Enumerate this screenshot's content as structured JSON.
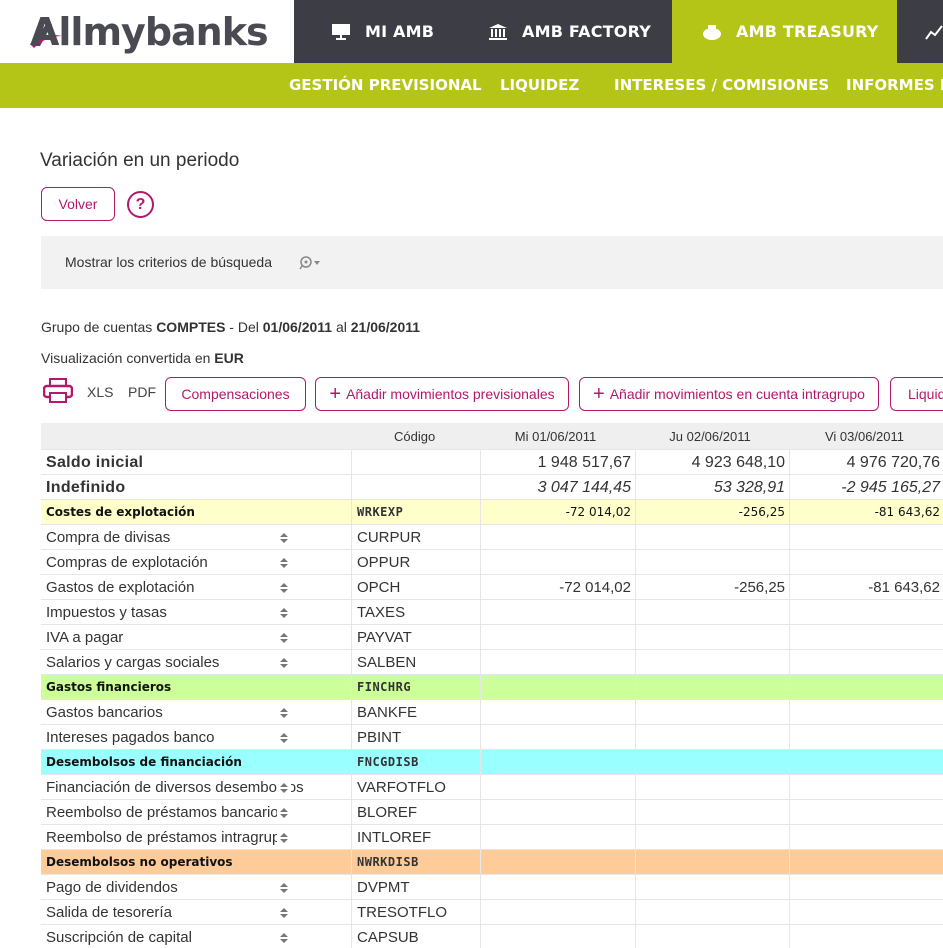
{
  "brand": {
    "logo_text": "Allmybanks",
    "accent": "#b5c517",
    "primary": "#b2196d",
    "dark": "#3d3d45"
  },
  "nav": {
    "items": [
      {
        "label": "MI AMB",
        "icon": "presentation-icon"
      },
      {
        "label": "AMB FACTORY",
        "icon": "bank-icon"
      },
      {
        "label": "AMB TREASURY",
        "icon": "piggy-bank-icon",
        "active": true
      },
      {
        "label": "",
        "icon": "chart-line-icon"
      }
    ]
  },
  "subnav": {
    "items": [
      "GESTIÓN PREVISIONAL",
      "LIQUIDEZ",
      "INTERESES / COMISIONES",
      "INFORMES DE"
    ]
  },
  "page": {
    "title": "Variación en un periodo",
    "back_label": "Volver",
    "help_label": "?",
    "criteria_label": "Mostrar los criterios de búsqueda"
  },
  "info": {
    "group_prefix": "Grupo de cuentas ",
    "group_name": "COMPTES",
    "from_prefix": " - Del ",
    "date_from": "01/06/2011",
    "to_prefix": " al ",
    "date_to": "21/06/2011",
    "currency_prefix": "Visualización convertida en ",
    "currency": "EUR"
  },
  "toolbar": {
    "xls": "XLS",
    "pdf": "PDF",
    "compensaciones": "Compensaciones",
    "add_prev": "Añadir movimientos previsionales",
    "add_intra": "Añadir movimientos en cuenta intragrupo",
    "liquid": "Liquid"
  },
  "table": {
    "headers": {
      "code": "Código",
      "d1": "Mi 01/06/2011",
      "d2": "Ju 02/06/2011",
      "d3": "Vi 03/06/2011"
    },
    "rows": [
      {
        "label": "Saldo inicial",
        "code": "",
        "v1": "1 948 517,67",
        "v2": "4 923 648,10",
        "v3": "4 976 720,76"
      },
      {
        "label": "Indefinido",
        "code": "",
        "v1": "3 047 144,45",
        "v2": "53 328,91",
        "v3": "-2 945 165,27"
      },
      {
        "label": "Costes de explotación",
        "code": "WRKEXP",
        "v1": "-72 014,02",
        "v2": "-256,25",
        "v3": "-81 643,62",
        "color": "#ffffcc"
      },
      {
        "label": "Compra de divisas",
        "code": "CURPUR",
        "v1": "",
        "v2": "",
        "v3": ""
      },
      {
        "label": "Compras de explotación",
        "code": "OPPUR",
        "v1": "",
        "v2": "",
        "v3": ""
      },
      {
        "label": "Gastos de explotación",
        "code": "OPCH",
        "v1": "-72 014,02",
        "v2": "-256,25",
        "v3": "-81 643,62"
      },
      {
        "label": "Impuestos y tasas",
        "code": "TAXES",
        "v1": "",
        "v2": "",
        "v3": ""
      },
      {
        "label": "IVA a pagar",
        "code": "PAYVAT",
        "v1": "",
        "v2": "",
        "v3": ""
      },
      {
        "label": "Salarios y cargas sociales",
        "code": "SALBEN",
        "v1": "",
        "v2": "",
        "v3": ""
      },
      {
        "label": "Gastos financieros",
        "code": "FINCHRG",
        "v1": "",
        "v2": "",
        "v3": "",
        "color": "#ccff99"
      },
      {
        "label": "Gastos bancarios",
        "code": "BANKFE",
        "v1": "",
        "v2": "",
        "v3": ""
      },
      {
        "label": "Intereses pagados banco",
        "code": "PBINT",
        "v1": "",
        "v2": "",
        "v3": ""
      },
      {
        "label": "Desembolsos de financiación",
        "code": "FNCGDISB",
        "v1": "",
        "v2": "",
        "v3": "",
        "color": "#99ffff"
      },
      {
        "label": "Financiación de diversos desembolsos",
        "code": "VARFOTFLO",
        "v1": "",
        "v2": "",
        "v3": ""
      },
      {
        "label": "Reembolso de préstamos bancarios",
        "code": "BLOREF",
        "v1": "",
        "v2": "",
        "v3": ""
      },
      {
        "label": "Reembolso de préstamos intragrupo",
        "code": "INTLOREF",
        "v1": "",
        "v2": "",
        "v3": ""
      },
      {
        "label": "Desembolsos no operativos",
        "code": "NWRKDISB",
        "v1": "",
        "v2": "",
        "v3": "",
        "color": "#ffcc99"
      },
      {
        "label": "Pago de dividendos",
        "code": "DVPMT",
        "v1": "",
        "v2": "",
        "v3": ""
      },
      {
        "label": "Salida de tesorería",
        "code": "TRESOTFLO",
        "v1": "",
        "v2": "",
        "v3": ""
      },
      {
        "label": "Suscripción de capital",
        "code": "CAPSUB",
        "v1": "",
        "v2": "",
        "v3": ""
      }
    ]
  }
}
